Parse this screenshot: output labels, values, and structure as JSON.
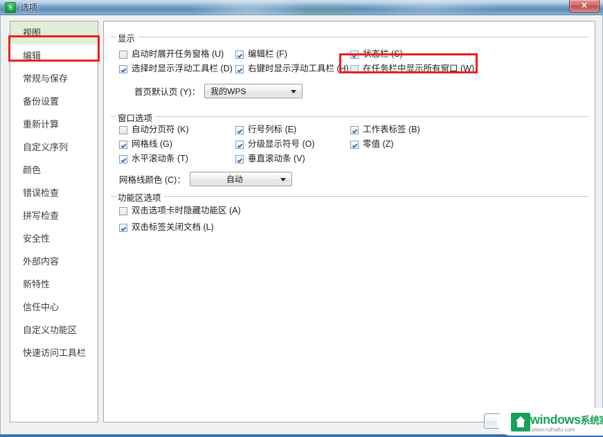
{
  "window": {
    "title": "选项",
    "icon": "wps-s-icon",
    "icon_letter": "S",
    "close_label": "✕"
  },
  "sidebar": {
    "items": [
      {
        "label": "视图",
        "selected": true
      },
      {
        "label": "编辑",
        "selected": false
      },
      {
        "label": "常规与保存",
        "selected": false
      },
      {
        "label": "备份设置",
        "selected": false
      },
      {
        "label": "重新计算",
        "selected": false
      },
      {
        "label": "自定义序列",
        "selected": false
      },
      {
        "label": "颜色",
        "selected": false
      },
      {
        "label": "错误检查",
        "selected": false
      },
      {
        "label": "拼写检查",
        "selected": false
      },
      {
        "label": "安全性",
        "selected": false
      },
      {
        "label": "外部内容",
        "selected": false
      },
      {
        "label": "新特性",
        "selected": false
      },
      {
        "label": "信任中心",
        "selected": false
      },
      {
        "label": "自定义功能区",
        "selected": false
      },
      {
        "label": "快速访问工具栏",
        "selected": false
      }
    ]
  },
  "groups": {
    "display": {
      "title": "显示",
      "checkboxes": [
        {
          "label": "启动时展开任务窗格 (U)",
          "checked": false,
          "highlighted": false
        },
        {
          "label": "选择时显示浮动工具栏 (D)",
          "checked": true,
          "highlighted": false
        },
        {
          "label": "编辑栏 (F)",
          "checked": true,
          "highlighted": false
        },
        {
          "label": "右键时显示浮动工具栏 (H)",
          "checked": true,
          "highlighted": false
        },
        {
          "label": "状态栏 (S)",
          "checked": true,
          "highlighted": false
        },
        {
          "label": "在任务栏中显示所有窗口 (W)",
          "checked": false,
          "highlighted": true
        }
      ],
      "field": {
        "label": "首页默认页 (Y)：",
        "value": "我的WPS"
      }
    },
    "window_options": {
      "title": "窗口选项",
      "checkboxes": [
        {
          "label": "自动分页符 (K)",
          "checked": false
        },
        {
          "label": "网格线 (G)",
          "checked": true
        },
        {
          "label": "水平滚动条 (T)",
          "checked": true
        },
        {
          "label": "行号列标 (E)",
          "checked": true
        },
        {
          "label": "分级显示符号 (O)",
          "checked": true
        },
        {
          "label": "垂直滚动条 (V)",
          "checked": true
        },
        {
          "label": "工作表标签 (B)",
          "checked": true
        },
        {
          "label": "零值 (Z)",
          "checked": true
        }
      ],
      "field": {
        "label": "网格线颜色 (C)：",
        "value": "自动"
      }
    },
    "ribbon_options": {
      "title": "功能区选项",
      "checkboxes": [
        {
          "label": "双击选项卡时隐藏功能区 (A)",
          "checked": false
        },
        {
          "label": "双击标签关闭文档 (L)",
          "checked": true
        }
      ]
    }
  },
  "watermark": {
    "main": "windows",
    "cn": "系统家园",
    "url": "www.ruihaifu.com"
  },
  "colors": {
    "accent_red": "#f01d1d",
    "selected_green": "#dfeed6",
    "watermark_green": "#19a05a",
    "titlebar_blue": "#5e8fba"
  }
}
